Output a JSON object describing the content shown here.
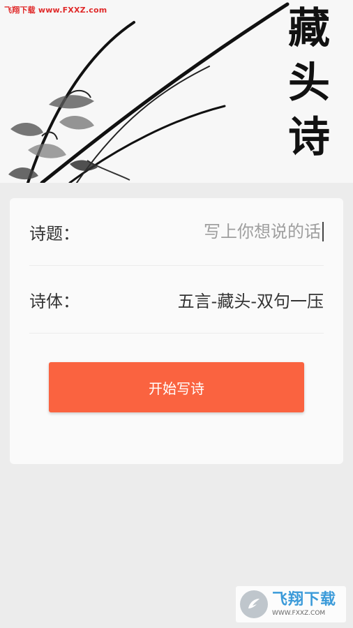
{
  "header": {
    "watermark_top": "飞翔下载 www.FXXZ.com",
    "title_chars": [
      "藏",
      "头",
      "诗"
    ]
  },
  "form": {
    "topic_label": "诗题：",
    "topic_placeholder": "写上你想说的话",
    "topic_value": "",
    "style_label": "诗体：",
    "style_value": "五言-藏头-双句一压",
    "start_button_label": "开始写诗"
  },
  "footer_watermark": {
    "brand": "飞翔下载",
    "url": "WWW.FXXZ.COM"
  },
  "colors": {
    "accent": "#fa6340",
    "background": "#ececec",
    "card": "#fafafa"
  },
  "icons": {
    "header_art": "orchid-ink-painting-icon",
    "footer_logo": "feixiang-logo-icon"
  }
}
